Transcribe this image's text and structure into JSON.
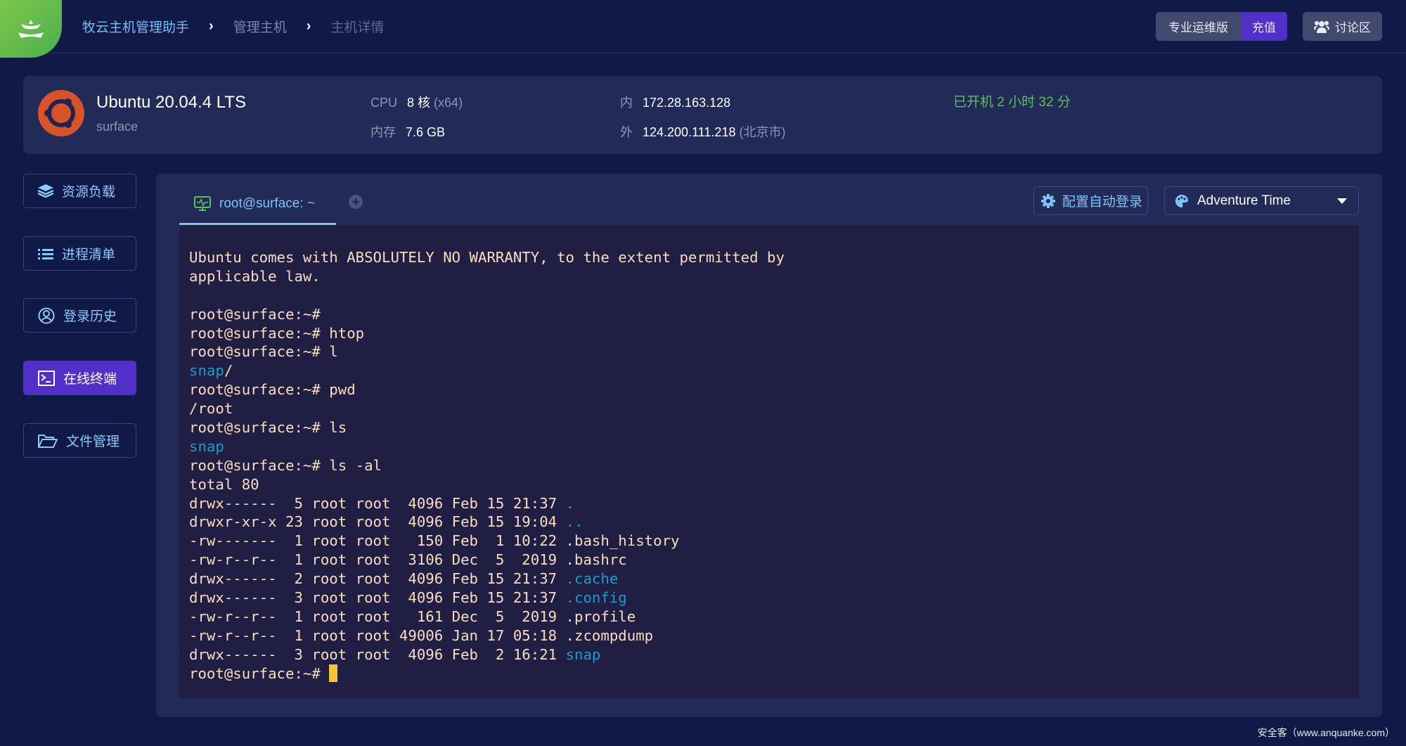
{
  "header": {
    "breadcrumb": [
      "牧云主机管理助手",
      "管理主机",
      "主机详情"
    ],
    "pro_label": "专业运维版",
    "charge_label": "充值",
    "forum_label": "讨论区"
  },
  "host": {
    "os": "Ubuntu 20.04.4 LTS",
    "hostname": "surface",
    "cpu_label": "CPU",
    "cpu_value": "8 核",
    "cpu_arch": "(x64)",
    "mem_label": "内存",
    "mem_value": "7.6 GB",
    "inner_label": "内",
    "inner_ip": "172.28.163.128",
    "outer_label": "外",
    "outer_ip": "124.200.111.218",
    "outer_location": "(北京市)",
    "uptime": "已开机 2 小时 32 分"
  },
  "sidebar": {
    "items": [
      {
        "label": "资源负载",
        "active": false
      },
      {
        "label": "进程清单",
        "active": false
      },
      {
        "label": "登录历史",
        "active": false
      },
      {
        "label": "在线终端",
        "active": true
      },
      {
        "label": "文件管理",
        "active": false
      }
    ]
  },
  "terminal": {
    "tab_title": "root@surface: ~",
    "auto_login_label": "配置自动登录",
    "theme_value": "Adventure Time",
    "colors": {
      "text": "#f8dcc0",
      "dir": "#1b9ccc",
      "cursor": "#f5c431",
      "background": "#201e43"
    },
    "lines": [
      {
        "pre": "Ubuntu comes with ABSOLUTELY NO WARRANTY, to the extent permitted by",
        "hl": "",
        "post": ""
      },
      {
        "pre": "applicable law.",
        "hl": "",
        "post": ""
      },
      {
        "pre": "",
        "hl": "",
        "post": ""
      },
      {
        "pre": "root@surface:~#",
        "hl": "",
        "post": ""
      },
      {
        "pre": "root@surface:~# htop",
        "hl": "",
        "post": ""
      },
      {
        "pre": "root@surface:~# l",
        "hl": "",
        "post": ""
      },
      {
        "pre": "",
        "hl": "snap",
        "post": "/"
      },
      {
        "pre": "root@surface:~# pwd",
        "hl": "",
        "post": ""
      },
      {
        "pre": "/root",
        "hl": "",
        "post": ""
      },
      {
        "pre": "root@surface:~# ls",
        "hl": "",
        "post": ""
      },
      {
        "pre": "",
        "hl": "snap",
        "post": ""
      },
      {
        "pre": "root@surface:~# ls -al",
        "hl": "",
        "post": ""
      },
      {
        "pre": "total 80",
        "hl": "",
        "post": ""
      },
      {
        "pre": "drwx------  5 root root  4096 Feb 15 21:37 ",
        "hl": ".",
        "post": ""
      },
      {
        "pre": "drwxr-xr-x 23 root root  4096 Feb 15 19:04 ",
        "hl": "..",
        "post": ""
      },
      {
        "pre": "-rw-------  1 root root   150 Feb  1 10:22 .bash_history",
        "hl": "",
        "post": ""
      },
      {
        "pre": "-rw-r--r--  1 root root  3106 Dec  5  2019 .bashrc",
        "hl": "",
        "post": ""
      },
      {
        "pre": "drwx------  2 root root  4096 Feb 15 21:37 ",
        "hl": ".cache",
        "post": ""
      },
      {
        "pre": "drwx------  3 root root  4096 Feb 15 21:37 ",
        "hl": ".config",
        "post": ""
      },
      {
        "pre": "-rw-r--r--  1 root root   161 Dec  5  2019 .profile",
        "hl": "",
        "post": ""
      },
      {
        "pre": "-rw-r--r--  1 root root 49006 Jan 17 05:18 .zcompdump",
        "hl": "",
        "post": ""
      },
      {
        "pre": "drwx------  3 root root  4096 Feb  2 16:21 ",
        "hl": "snap",
        "post": ""
      }
    ],
    "prompt": "root@surface:~# "
  },
  "footer": {
    "watermark": "安全客（www.anquanke.com）"
  }
}
